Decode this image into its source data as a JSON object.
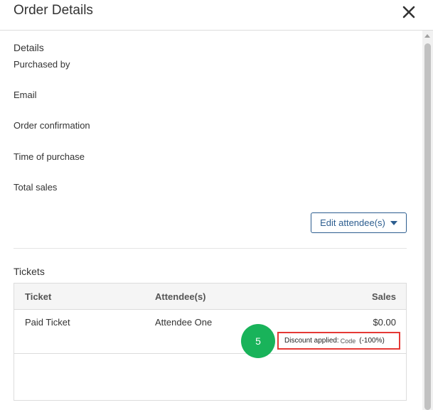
{
  "header": {
    "title": "Order Details",
    "close_icon": "close-icon"
  },
  "details": {
    "title": "Details",
    "fields": [
      "Purchased by",
      "Email",
      "Order confirmation",
      "Time of purchase",
      "Total sales"
    ],
    "edit_button": "Edit attendee(s)",
    "edit_icon": "caret-down-icon"
  },
  "tickets": {
    "title": "Tickets",
    "columns": [
      "Ticket",
      "Attendee(s)",
      "Sales"
    ],
    "rows": [
      {
        "ticket": "Paid Ticket",
        "attendee": "Attendee One",
        "sales": "$0.00",
        "step_badge": "5",
        "discount_label": "Discount applied:",
        "discount_code": "Code",
        "discount_pct": "(-100%)"
      }
    ]
  },
  "colors": {
    "accent": "#2c5d8f",
    "badge": "#19b35a",
    "highlight": "#e53935"
  }
}
